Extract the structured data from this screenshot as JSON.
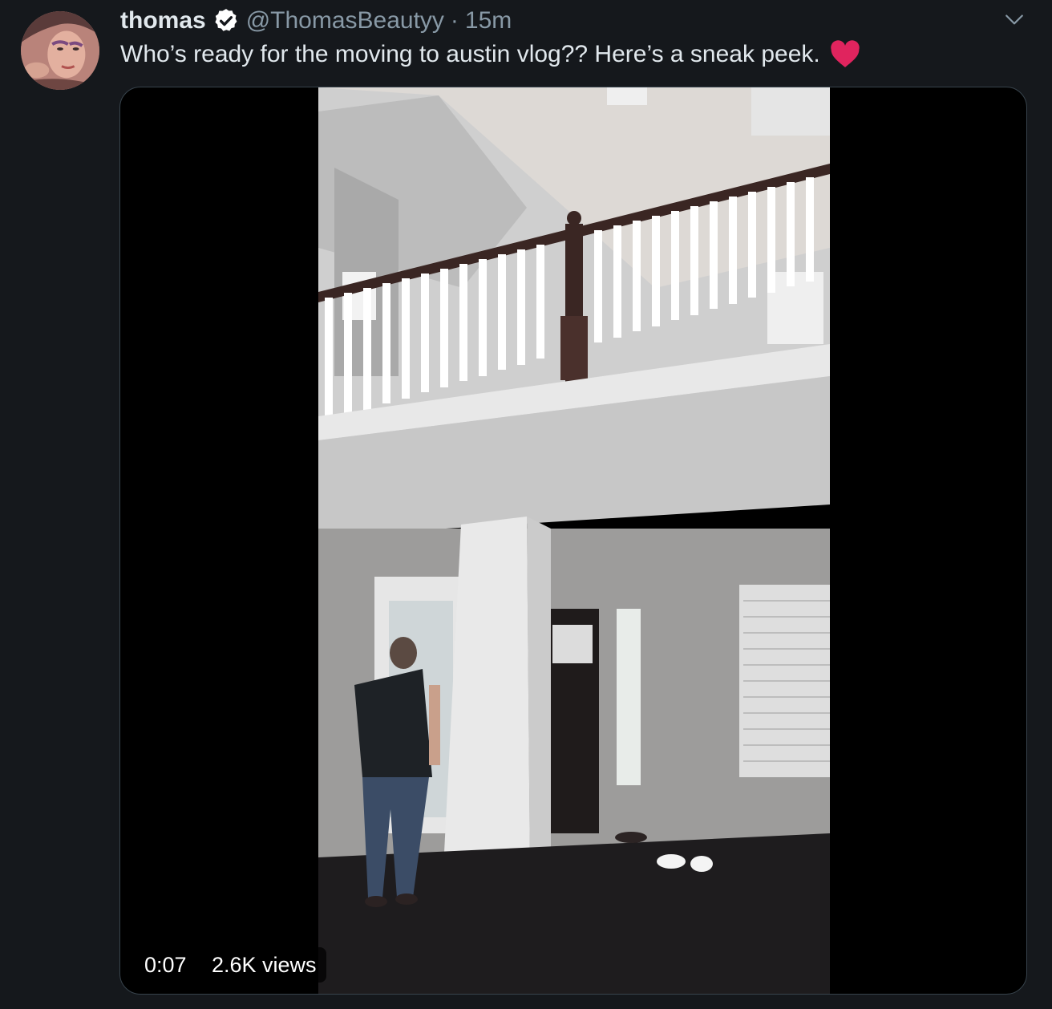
{
  "tweet": {
    "display_name": "thomas",
    "handle": "@ThomasBeautyy",
    "separator": "·",
    "timestamp": "15m",
    "text": "Who’s ready for the moving to austin vlog?? Here’s a sneak peek.",
    "emoji": "heart-icon"
  },
  "media": {
    "duration": "0:07",
    "views": "2.6K views"
  },
  "icons": {
    "verified": "verified-icon",
    "more": "caret-icon",
    "heart_color": "#e0245e"
  },
  "colors": {
    "background": "#15181c",
    "secondary_text": "#8899a6",
    "primary_text": "#e1e8ed"
  }
}
